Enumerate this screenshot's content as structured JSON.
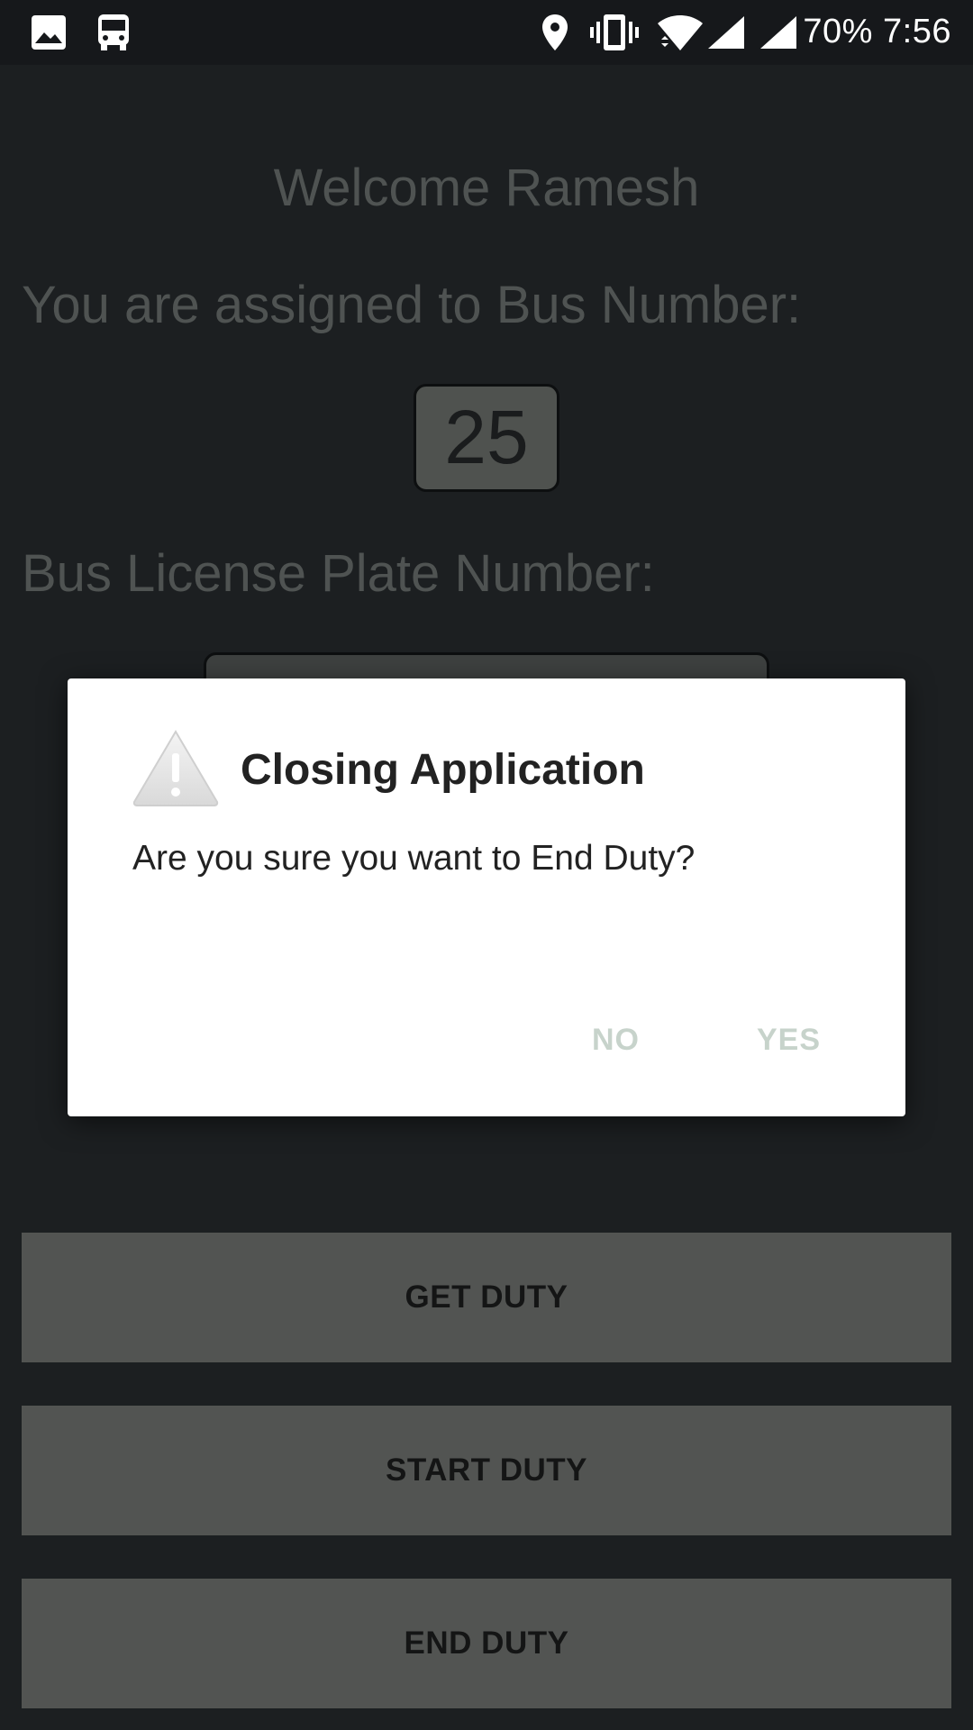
{
  "status_bar": {
    "battery": "70%",
    "time": "7:56",
    "icons": [
      "image-icon",
      "bus-icon",
      "location-icon",
      "vibrate-icon",
      "wifi-icon",
      "signal-icon",
      "signal-icon"
    ]
  },
  "main": {
    "welcome": "Welcome Ramesh",
    "assigned_label": "You are assigned to Bus Number:",
    "bus_number": "25",
    "plate_label": "Bus License Plate Number:",
    "plate_value": ""
  },
  "buttons": {
    "get_duty": "GET DUTY",
    "start_duty": "START DUTY",
    "end_duty": "END DUTY"
  },
  "dialog": {
    "title": "Closing Application",
    "message": "Are you sure you want to End Duty?",
    "no_label": "NO",
    "yes_label": "YES",
    "icon": "warning-icon"
  },
  "colors": {
    "background": "#1c1f21",
    "dim_text": "#4f5352",
    "button_bg": "#525452",
    "dialog_button_text": "#c7d3cb"
  }
}
